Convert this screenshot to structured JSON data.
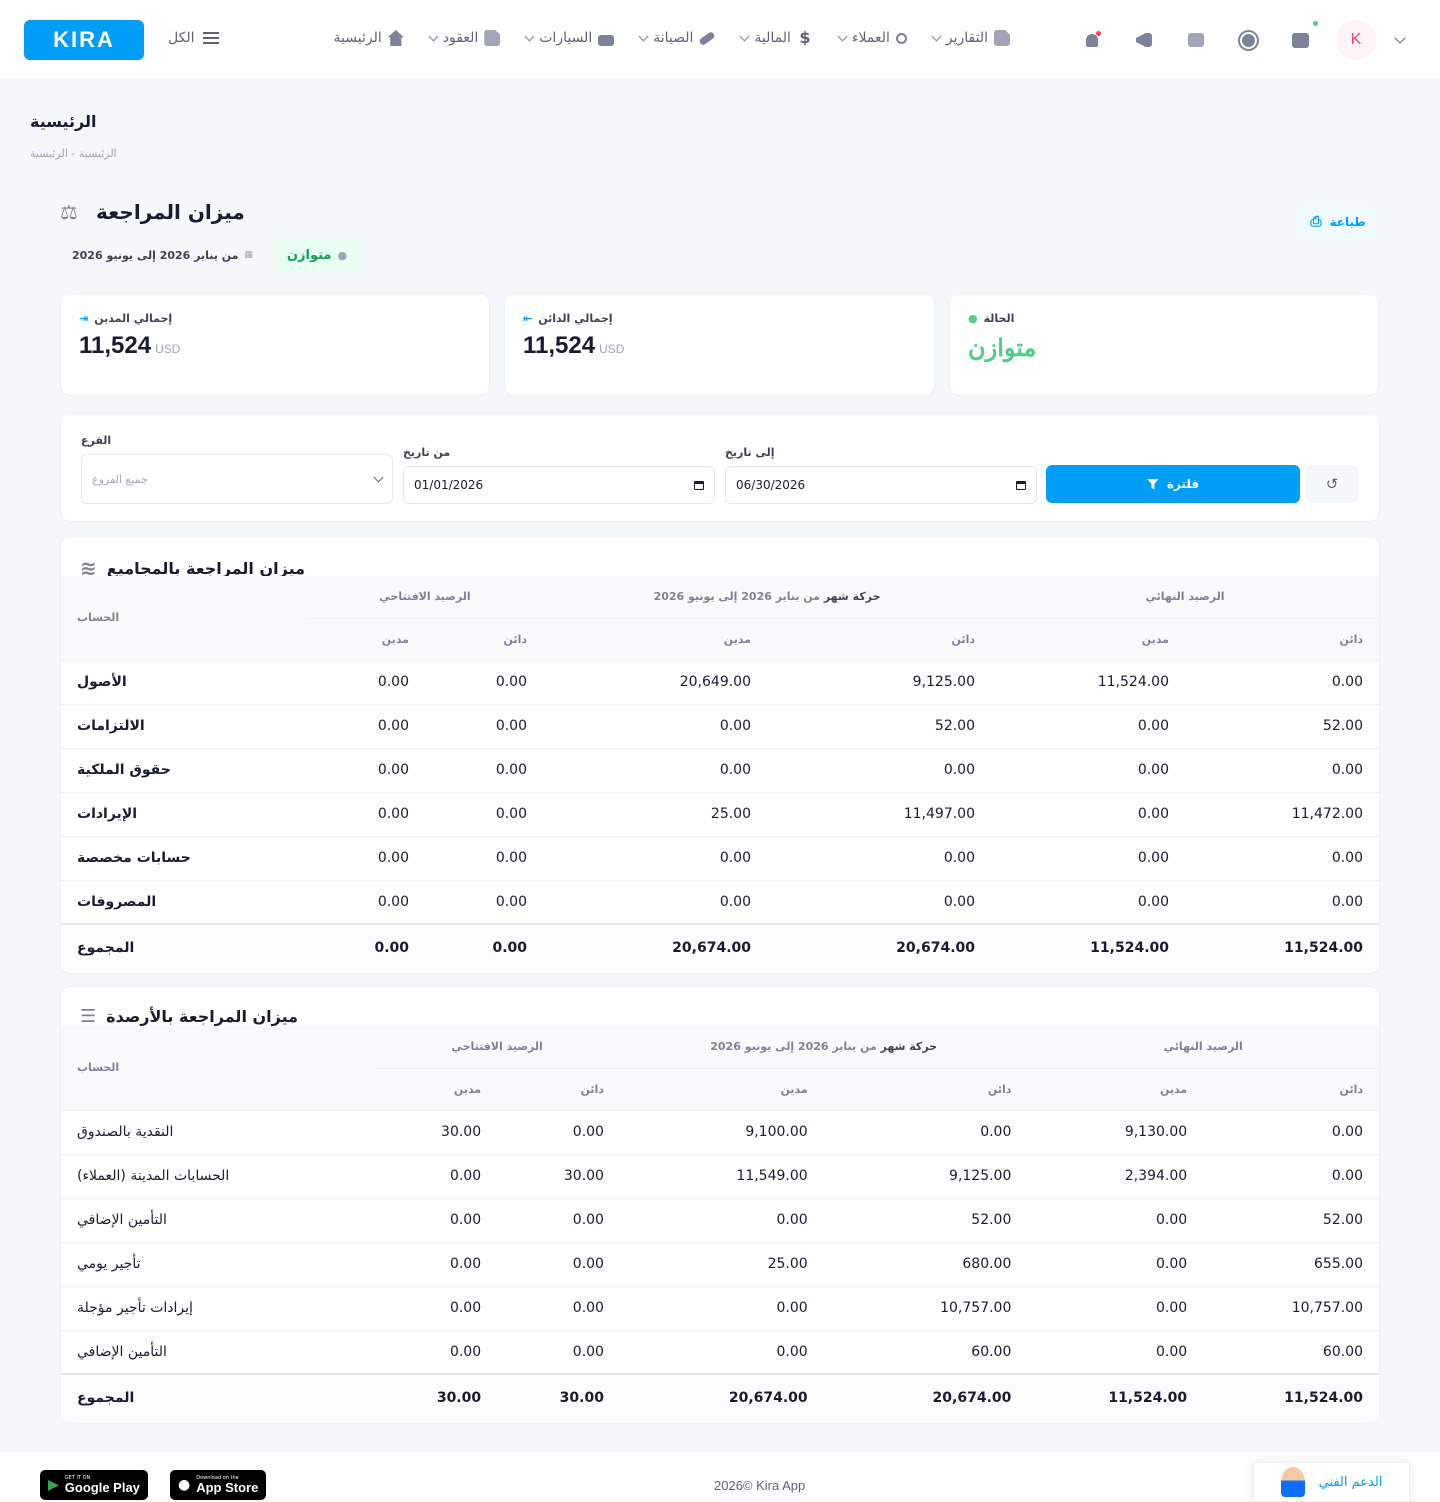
{
  "brand": {
    "logo": "KIRA",
    "all_label": "الكل"
  },
  "nav": [
    {
      "label": "الرئيسية",
      "icon": "home-icon",
      "dropdown": false
    },
    {
      "label": "العقود",
      "icon": "document-icon",
      "dropdown": true
    },
    {
      "label": "السيارات",
      "icon": "car-icon",
      "dropdown": true
    },
    {
      "label": "الصيانة",
      "icon": "wrench-icon",
      "dropdown": true
    },
    {
      "label": "المالية",
      "icon": "dollar-icon",
      "dropdown": true
    },
    {
      "label": "العملاء",
      "icon": "users-icon",
      "dropdown": true
    },
    {
      "label": "التقارير",
      "icon": "report-icon",
      "dropdown": true
    }
  ],
  "header_icons": [
    "bell-icon",
    "megaphone-icon",
    "chat-icon",
    "sun-icon",
    "box-icon"
  ],
  "avatar": {
    "initial": "K"
  },
  "page": {
    "title": "الرئيسية",
    "breadcrumb": "الرئيسية  -  الرئيسية"
  },
  "report": {
    "title": "ميزان المراجعة",
    "print_label": "طباعة",
    "status_tag": "متوازن",
    "date_range": "من يناير 2026 إلى يونيو 2026"
  },
  "stats": {
    "debit": {
      "label": "إجمالي المدين",
      "value": "11,524",
      "unit": "USD"
    },
    "credit": {
      "label": "إجمالي الدائن",
      "value": "11,524",
      "unit": "USD"
    },
    "status": {
      "label": "الحالة",
      "value": "متوازن"
    }
  },
  "filters": {
    "branch_label": "الفرع",
    "branch_placeholder": "جميع الفروع",
    "from_label": "من تاريخ",
    "from_value": "01/01/2026",
    "to_label": "إلى تاريخ",
    "to_value": "06/30/2026",
    "filter_label": "فلترة"
  },
  "table_headers": {
    "account": "الحساب",
    "opening": "الرصيد الافتتاحي",
    "movement_prefix": "حركة شهر",
    "movement_range": "من يناير 2026 إلى يونيو 2026",
    "closing": "الرصيد النهائي",
    "debit": "مدين",
    "credit": "دائن"
  },
  "groups_table": {
    "title": "ميزان المراجعة بالمجاميع",
    "rows": [
      {
        "account": "الأصول",
        "od": "0.00",
        "oc": "0.00",
        "md": "20,649.00",
        "mc": "9,125.00",
        "cd": "11,524.00",
        "cc": "0.00"
      },
      {
        "account": "الالتزامات",
        "od": "0.00",
        "oc": "0.00",
        "md": "0.00",
        "mc": "52.00",
        "cd": "0.00",
        "cc": "52.00"
      },
      {
        "account": "حقوق الملكية",
        "od": "0.00",
        "oc": "0.00",
        "md": "0.00",
        "mc": "0.00",
        "cd": "0.00",
        "cc": "0.00"
      },
      {
        "account": "الإيرادات",
        "od": "0.00",
        "oc": "0.00",
        "md": "25.00",
        "mc": "11,497.00",
        "cd": "0.00",
        "cc": "11,472.00"
      },
      {
        "account": "حسابات مخصصة",
        "od": "0.00",
        "oc": "0.00",
        "md": "0.00",
        "mc": "0.00",
        "cd": "0.00",
        "cc": "0.00"
      },
      {
        "account": "المصروفات",
        "od": "0.00",
        "oc": "0.00",
        "md": "0.00",
        "mc": "0.00",
        "cd": "0.00",
        "cc": "0.00"
      }
    ],
    "total": {
      "account": "المجموع",
      "od": "0.00",
      "oc": "0.00",
      "md": "20,674.00",
      "mc": "20,674.00",
      "cd": "11,524.00",
      "cc": "11,524.00"
    }
  },
  "balances_table": {
    "title": "ميزان المراجعة بالأرصدة",
    "rows": [
      {
        "account": "النقدية بالصندوق",
        "od": "30.00",
        "oc": "0.00",
        "md": "9,100.00",
        "mc": "0.00",
        "cd": "9,130.00",
        "cc": "0.00"
      },
      {
        "account": "الحسابات المدينة (العملاء)",
        "od": "0.00",
        "oc": "30.00",
        "md": "11,549.00",
        "mc": "9,125.00",
        "cd": "2,394.00",
        "cc": "0.00"
      },
      {
        "account": "التأمين الإضافي",
        "od": "0.00",
        "oc": "0.00",
        "md": "0.00",
        "mc": "52.00",
        "cd": "0.00",
        "cc": "52.00"
      },
      {
        "account": "تأجير يومي",
        "od": "0.00",
        "oc": "0.00",
        "md": "25.00",
        "mc": "680.00",
        "cd": "0.00",
        "cc": "655.00"
      },
      {
        "account": "إيرادات تأجير مؤجلة",
        "od": "0.00",
        "oc": "0.00",
        "md": "0.00",
        "mc": "10,757.00",
        "cd": "0.00",
        "cc": "10,757.00"
      },
      {
        "account": "التأمين الإضافي",
        "od": "0.00",
        "oc": "0.00",
        "md": "0.00",
        "mc": "60.00",
        "cd": "0.00",
        "cc": "60.00"
      }
    ],
    "total": {
      "account": "المجموع",
      "od": "30.00",
      "oc": "30.00",
      "md": "20,674.00",
      "mc": "20,674.00",
      "cd": "11,524.00",
      "cc": "11,524.00"
    }
  },
  "footer": {
    "google_small": "GET IT ON",
    "google_big": "Google Play",
    "apple_small": "Download on the",
    "apple_big": "App Store",
    "copyright": "2026©  Kira App",
    "support_label": "الدعم الفني"
  },
  "colors": {
    "primary": "#009ef7",
    "success": "#50cd89",
    "danger": "#f1416c"
  }
}
